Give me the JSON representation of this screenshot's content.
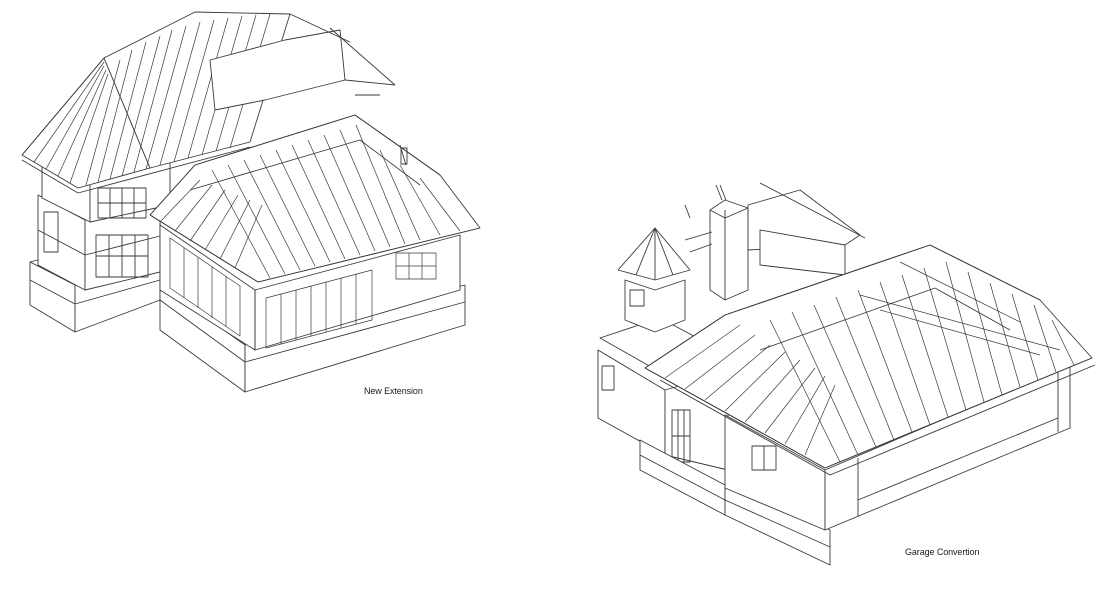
{
  "drawings": [
    {
      "caption": "New Extension"
    },
    {
      "caption": "Garage Convertion"
    }
  ],
  "colors": {
    "line": "#3a3a3a",
    "paper": "#ffffff"
  }
}
